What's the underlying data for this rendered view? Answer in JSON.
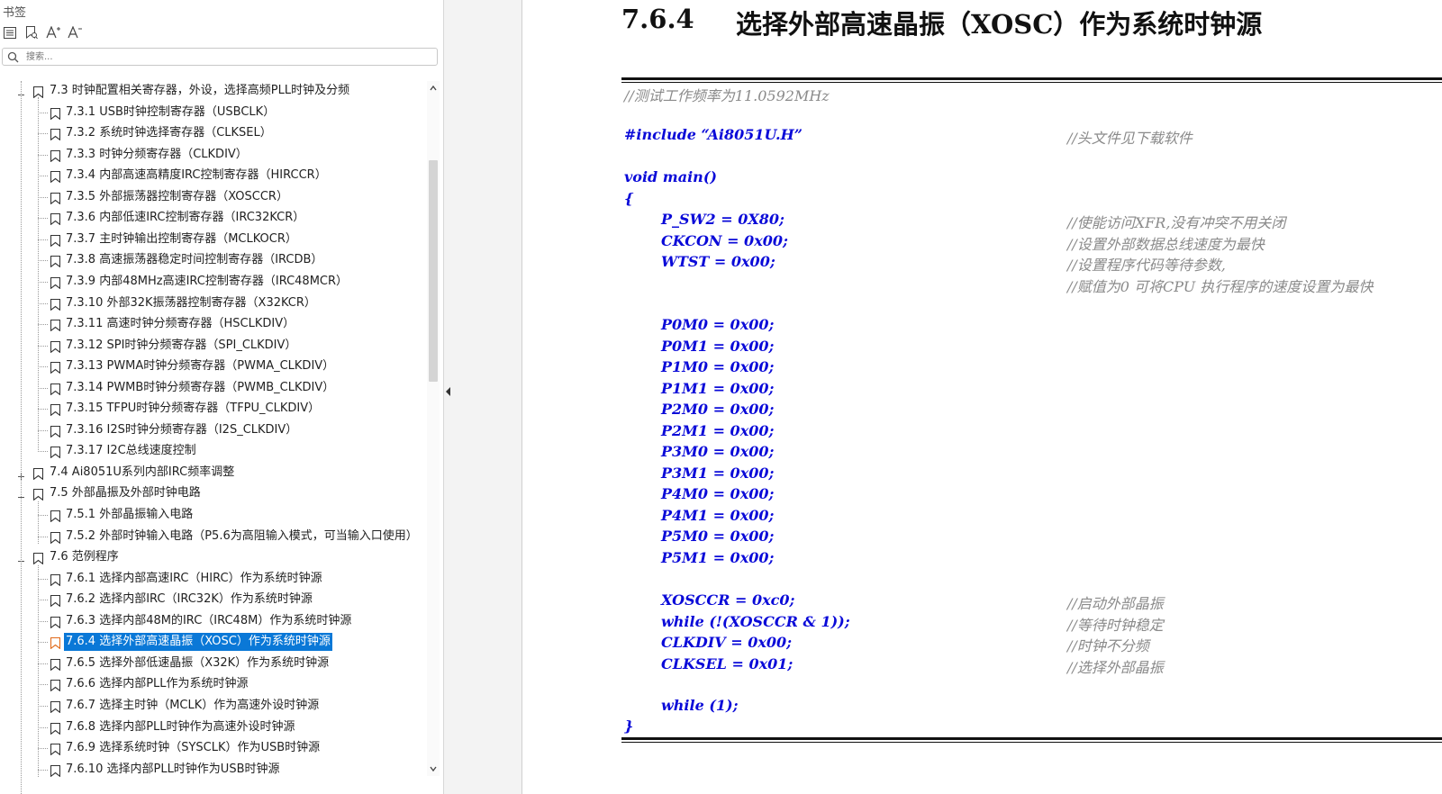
{
  "panel": {
    "title": "书签",
    "search_placeholder": "搜索..."
  },
  "tree": [
    {
      "label": "7.3  时钟配置相关寄存器，外设，选择高频PLL时钟及分频",
      "level": 1,
      "expanded": true
    },
    {
      "label": "7.3.1  USB时钟控制寄存器（USBCLK）",
      "level": 2
    },
    {
      "label": "7.3.2  系统时钟选择寄存器（CLKSEL）",
      "level": 2
    },
    {
      "label": "7.3.3 时钟分频寄存器（CLKDIV）",
      "level": 2
    },
    {
      "label": "7.3.4  内部高速高精度IRC控制寄存器（HIRCCR）",
      "level": 2
    },
    {
      "label": "7.3.5 外部振荡器控制寄存器（XOSCCR）",
      "level": 2
    },
    {
      "label": "7.3.6  内部低速IRC控制寄存器（IRC32KCR）",
      "level": 2
    },
    {
      "label": "7.3.7  主时钟输出控制寄存器（MCLKOCR）",
      "level": 2
    },
    {
      "label": "7.3.8 高速振荡器稳定时间控制寄存器（IRCDB）",
      "level": 2
    },
    {
      "label": "7.3.9 内部48MHz高速IRC控制寄存器（IRC48MCR）",
      "level": 2
    },
    {
      "label": "7.3.10  外部32K振荡器控制寄存器（X32KCR）",
      "level": 2
    },
    {
      "label": "7.3.11 高速时钟分频寄存器（HSCLKDIV）",
      "level": 2
    },
    {
      "label": "7.3.12 SPI时钟分频寄存器（SPI_CLKDIV）",
      "level": 2
    },
    {
      "label": "7.3.13  PWMA时钟分频寄存器（PWMA_CLKDIV）",
      "level": 2
    },
    {
      "label": "7.3.14 PWMB时钟分频寄存器（PWMB_CLKDIV）",
      "level": 2
    },
    {
      "label": "7.3.15 TFPU时钟分频寄存器（TFPU_CLKDIV）",
      "level": 2
    },
    {
      "label": "7.3.16  I2S时钟分频寄存器（I2S_CLKDIV）",
      "level": 2
    },
    {
      "label": "7.3.17 I2C总线速度控制",
      "level": 2
    },
    {
      "label": "7.4  Ai8051U系列内部IRC频率调整",
      "level": 1,
      "expanded": false
    },
    {
      "label": "7.5  外部晶振及外部时钟电路",
      "level": 1,
      "expanded": true
    },
    {
      "label": "7.5.1 外部晶振输入电路",
      "level": 2
    },
    {
      "label": "7.5.2 外部时钟输入电路（P5.6为高阻输入模式，可当输入口使用）",
      "level": 2
    },
    {
      "label": "7.6  范例程序",
      "level": 1,
      "expanded": true
    },
    {
      "label": "7.6.1 选择内部高速IRC（HIRC）作为系统时钟源",
      "level": 2
    },
    {
      "label": "7.6.2 选择内部IRC（IRC32K）作为系统时钟源",
      "level": 2
    },
    {
      "label": "7.6.3 选择内部48M的IRC（IRC48M）作为系统时钟源",
      "level": 2
    },
    {
      "label": "7.6.4 选择外部高速晶振（XOSC）作为系统时钟源",
      "level": 2,
      "selected": true
    },
    {
      "label": "7.6.5 选择外部低速晶振（X32K）作为系统时钟源",
      "level": 2
    },
    {
      "label": "7.6.6 选择内部PLL作为系统时钟源",
      "level": 2
    },
    {
      "label": "7.6.7 选择主时钟（MCLK）作为高速外设时钟源",
      "level": 2
    },
    {
      "label": "7.6.8 选择内部PLL时钟作为高速外设时钟源",
      "level": 2
    },
    {
      "label": "7.6.9 选择系统时钟（SYSCLK）作为USB时钟源",
      "level": 2
    },
    {
      "label": "7.6.10 选择内部PLL时钟作为USB时钟源",
      "level": 2
    }
  ],
  "doc": {
    "heading_number": "7.6.4",
    "heading_title": "选择外部高速晶振（XOSC）作为系统时钟源",
    "freq_comment": "//测试工作频率为11.0592MHz",
    "include_line": "#include “Ai8051U.H”",
    "include_comment": "//头文件见下载软件",
    "main_decl": "void main()",
    "open_brace": "{",
    "close_brace": "}",
    "stmts1": [
      {
        "code": "P_SW2 = 0X80;",
        "comment": "//使能访问XFR,没有冲突不用关闭"
      },
      {
        "code": "CKCON = 0x00;",
        "comment": "//设置外部数据总线速度为最快"
      },
      {
        "code": "WTST = 0x00;",
        "comment": "//设置程序代码等待参数,"
      },
      {
        "code": "",
        "comment": "//赋值为0 可将CPU 执行程序的速度设置为最快"
      }
    ],
    "ports": [
      "P0M0 = 0x00;",
      "P0M1 = 0x00;",
      "P1M0 = 0x00;",
      "P1M1 = 0x00;",
      "P2M0 = 0x00;",
      "P2M1 = 0x00;",
      "P3M0 = 0x00;",
      "P3M1 = 0x00;",
      "P4M0 = 0x00;",
      "P4M1 = 0x00;",
      "P5M0 = 0x00;",
      "P5M1 = 0x00;"
    ],
    "stmts2": [
      {
        "code": "XOSCCR = 0xc0;",
        "comment": "//启动外部晶振"
      },
      {
        "code": "while (!(XOSCCR & 1));",
        "comment": "//等待时钟稳定"
      },
      {
        "code": "CLKDIV = 0x00;",
        "comment": "//时钟不分频"
      },
      {
        "code": "CLKSEL = 0x01;",
        "comment": "//选择外部晶振"
      }
    ],
    "loop": "while (1);"
  }
}
